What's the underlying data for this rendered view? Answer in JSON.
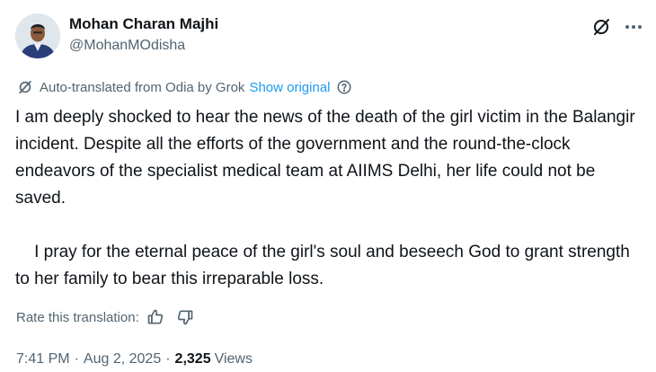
{
  "author": {
    "display_name": "Mohan Charan Majhi",
    "handle": "@MohanMOdisha",
    "avatar": "avatar-photo"
  },
  "header_icons": [
    "grok-slash-icon",
    "more-options-icon"
  ],
  "translation": {
    "label": "Auto-translated from Odia by Grok",
    "show_original": "Show original",
    "icon": "translate-slash-icon"
  },
  "post": {
    "text": "I am deeply shocked to hear the news of the death of the girl victim in the Balangir incident. Despite all the efforts of the government and the round-the-clock endeavors of the specialist medical team at AIIMS Delhi, her life could not be saved.\n\n    I pray for the eternal peace of the girl's soul and beseech God to grant strength to her family to bear this irreparable loss."
  },
  "rating": {
    "label": "Rate this translation:",
    "icons": [
      "thumbs-up-icon",
      "thumbs-down-icon"
    ]
  },
  "meta": {
    "time": "7:41 PM",
    "separator": "·",
    "date": "Aug 2, 2025",
    "views_count": "2,325",
    "views_label": "Views"
  },
  "colors": {
    "text_primary": "#0f1419",
    "text_secondary": "#536471",
    "link": "#1d9bf0"
  }
}
